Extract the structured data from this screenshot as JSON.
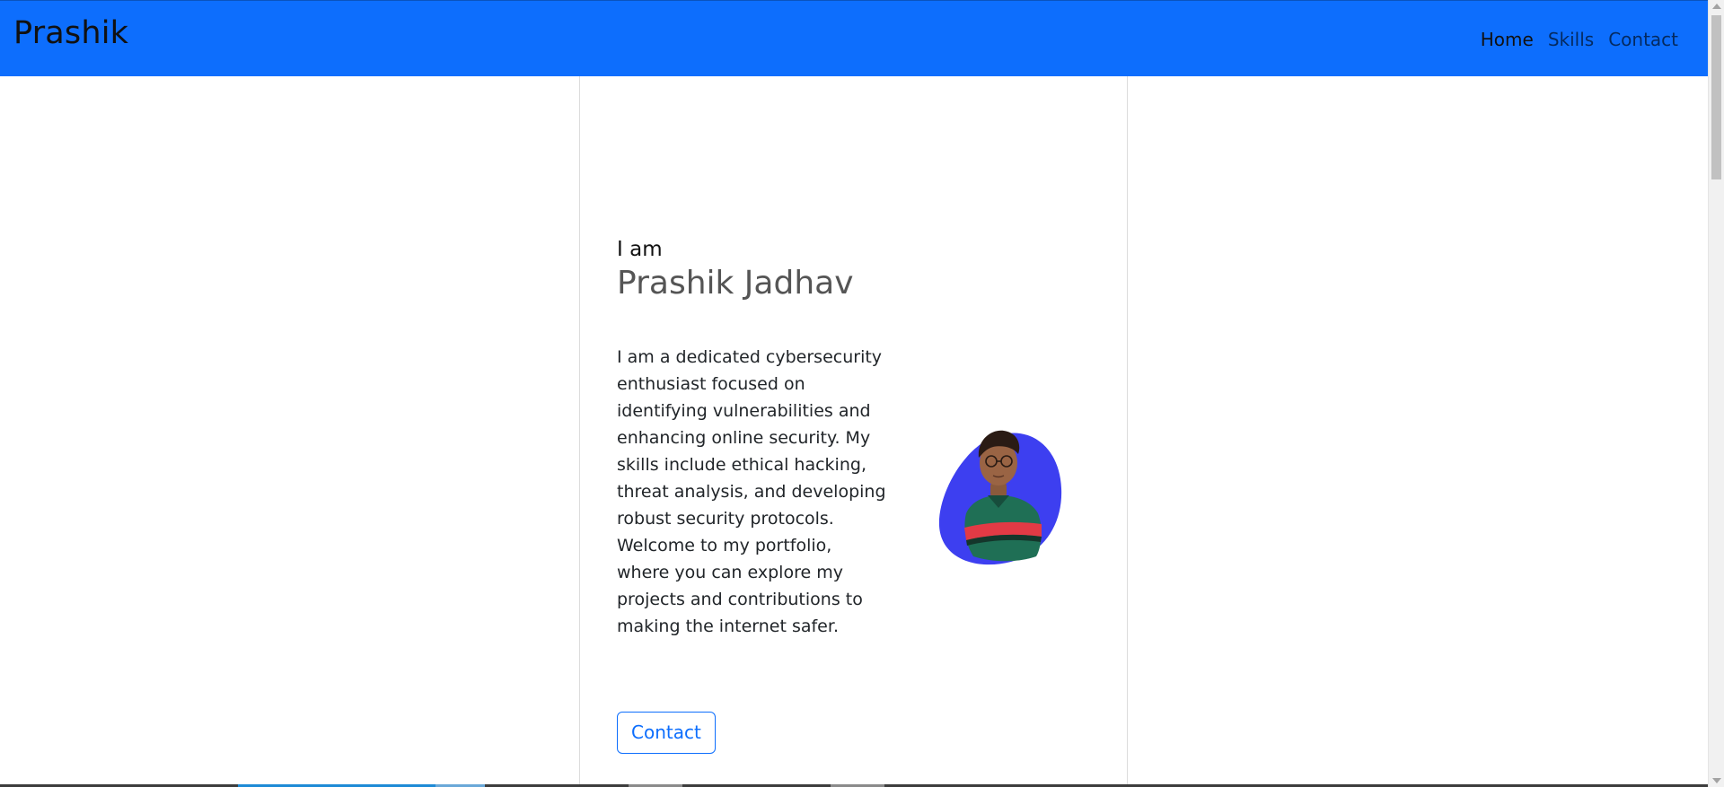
{
  "navbar": {
    "brand": "Prashik",
    "links": [
      {
        "label": "Home",
        "active": true
      },
      {
        "label": "Skills",
        "active": false
      },
      {
        "label": "Contact",
        "active": false
      }
    ],
    "background_color": "#0d6efd"
  },
  "hero": {
    "greeting": "I am",
    "name": "Prashik Jadhav",
    "bio": "I am a dedicated cybersecurity enthusiast focused on identifying vulnerabilities and enhancing online security. My skills include ethical hacking, threat analysis, and developing robust security protocols. Welcome to my portfolio, where you can explore my projects and contributions to making the internet safer.",
    "contact_button": "Contact",
    "avatar_icon": "profile-photo",
    "avatar_blob_color": "#3d3ff0"
  },
  "colors": {
    "accent": "#0d6efd",
    "name_text": "#555555",
    "body_text": "#212529"
  }
}
